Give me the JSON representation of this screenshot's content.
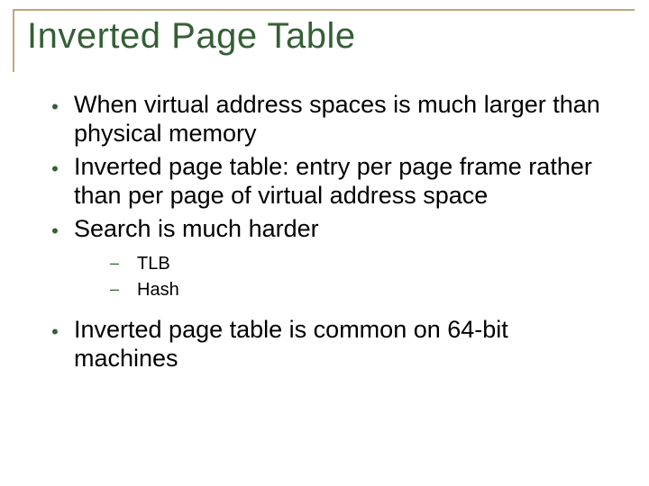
{
  "title": "Inverted Page Table",
  "bullets": {
    "b1": "When virtual address spaces is much larger than physical memory",
    "b2": "Inverted page table: entry per page frame rather than per page of virtual address space",
    "b3": "Search is much harder",
    "b3_sub": {
      "s1": "TLB",
      "s2": "Hash"
    },
    "b4": "Inverted page table is common on 64-bit machines"
  }
}
